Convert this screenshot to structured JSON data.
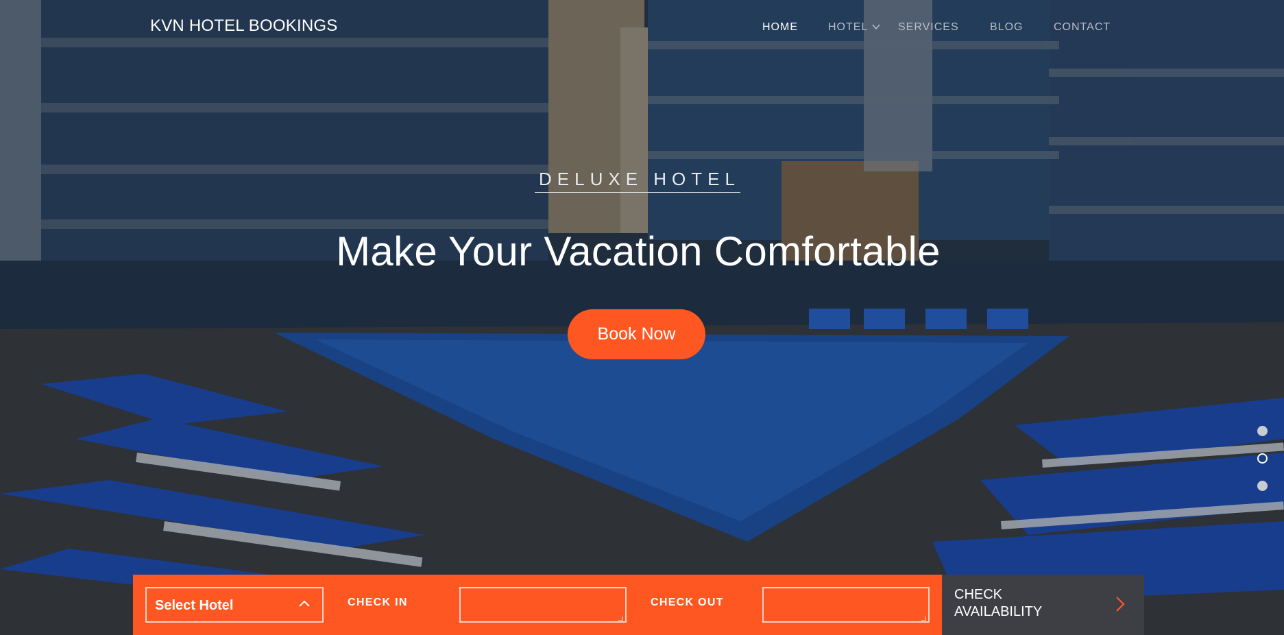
{
  "brand": {
    "name": "KVN HOTEL BOOKINGS"
  },
  "nav": {
    "items": [
      {
        "label": "HOME",
        "active": true
      },
      {
        "label": "HOTEL",
        "has_dropdown": true
      },
      {
        "label": "SERVICES"
      },
      {
        "label": "BLOG"
      },
      {
        "label": "CONTACT"
      }
    ]
  },
  "hero": {
    "eyebrow": "DELUXE HOTEL",
    "headline": "Make Your Vacation Comfortable",
    "cta_label": "Book Now",
    "slider": {
      "count": 3,
      "active_index": 1
    }
  },
  "booking": {
    "select_hotel": {
      "label": "Select Hotel",
      "icon": "chevron-up-icon"
    },
    "check_in": {
      "label": "CHECK IN",
      "value": ""
    },
    "check_out": {
      "label": "CHECK OUT",
      "value": ""
    },
    "submit": {
      "label": "CHECK AVAILABILITY",
      "icon": "chevron-right-icon"
    }
  },
  "colors": {
    "accent": "#ff5722",
    "submit_bg": "#3d3f44",
    "text": "#ffffff",
    "nav_inactive": "#b9bfc6"
  }
}
